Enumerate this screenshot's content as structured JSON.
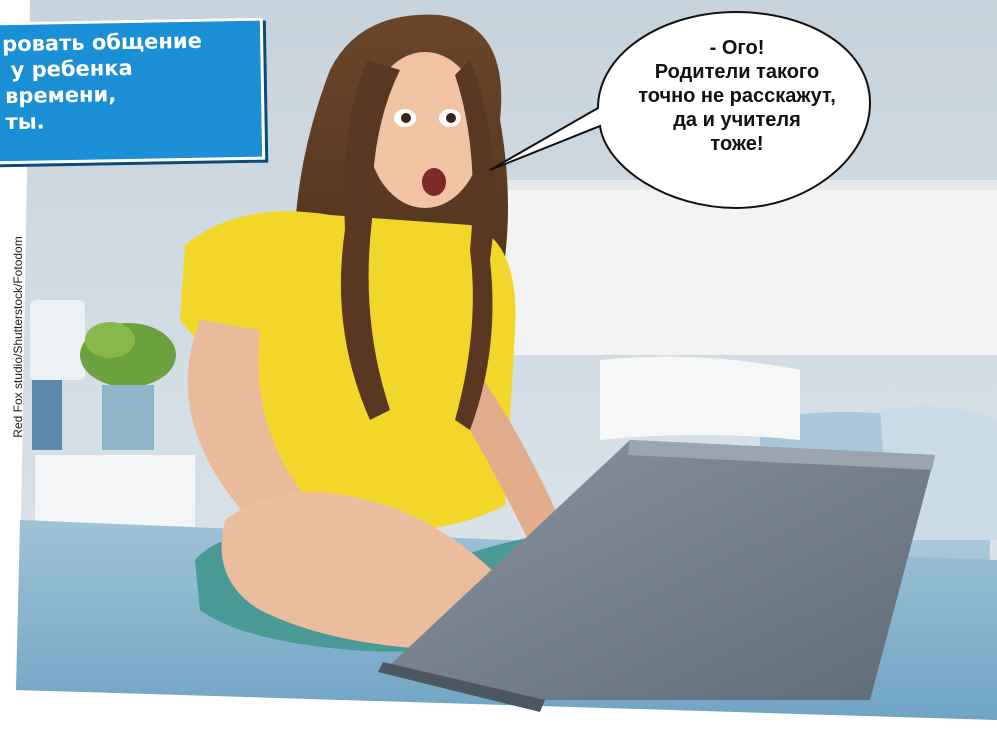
{
  "caption_box": {
    "lines": [
      "ровать общение",
      "у ребенка",
      "времени,",
      "ты."
    ]
  },
  "speech_bubble": {
    "lines": [
      "- Ого!",
      "Родители такого",
      "точно не расскажут,",
      "да и учителя",
      "тоже!"
    ]
  },
  "photo_credit": "Red Fox studio/Shutterstock/Fotodom",
  "colors": {
    "caption_bg": "#1b8fd6",
    "shirt": "#f2d62a",
    "laptop": "#6f7c8a"
  }
}
